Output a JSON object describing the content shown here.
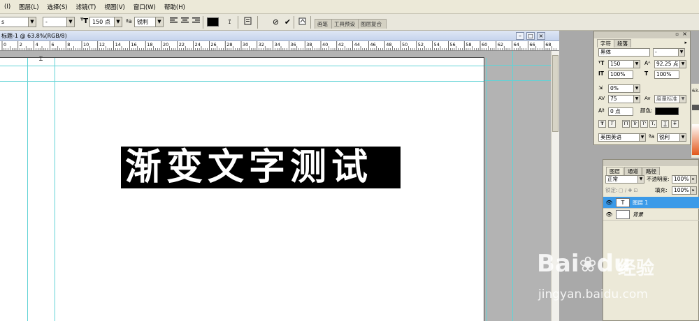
{
  "menu": [
    "图层(L)",
    "选择(S)",
    "滤镜(T)",
    "视图(V)",
    "窗口(W)",
    "帮助(H)"
  ],
  "menu_prefix": "(I)",
  "options": {
    "font_style": "-",
    "font_size": "150 点",
    "aa_label": "a",
    "aa_value": "锐利",
    "tabs": [
      "画笔",
      "工具预设",
      "图层复合"
    ]
  },
  "document": {
    "title": "标题-1 @ 63.8%(RGB/8)",
    "text": "渐变文字测试",
    "ruler_labels": [
      "0",
      "2",
      "4",
      "6",
      "8",
      "10",
      "12",
      "14",
      "16",
      "18",
      "20",
      "22",
      "24",
      "26",
      "28",
      "30",
      "32",
      "34",
      "36",
      "38",
      "40",
      "42",
      "44",
      "46",
      "48",
      "50",
      "52",
      "54",
      "56",
      "58",
      "60",
      "62",
      "64",
      "66",
      "68"
    ]
  },
  "char_panel": {
    "tab_char": "字符",
    "tab_para": "段落",
    "font_family": "黑体",
    "font_style": "-",
    "size": "150",
    "leading": "92.25 点",
    "vscale": "100%",
    "hscale": "100%",
    "tracking_pct": "0%",
    "kerning": "75",
    "kerning_mode": "度量标准",
    "baseline": "0 点",
    "color_label": "颜色:",
    "style_buttons": [
      "T",
      "T",
      "TT",
      "Tr",
      "T'",
      "T,",
      "T",
      "T"
    ],
    "language": "美国英语",
    "aa_label": "a",
    "aa_value": "锐利"
  },
  "side_readout": "63.",
  "layers_panel": {
    "tabs": [
      "图层",
      "通道",
      "路径"
    ],
    "blend_mode": "正常",
    "opacity_label": "不透明度:",
    "opacity": "100%",
    "lock_label": "锁定:",
    "fill_label": "填充:",
    "fill": "100%",
    "layers": [
      {
        "name": "图层 1",
        "thumb": "T",
        "selected": true
      },
      {
        "name": "背景",
        "thumb": "",
        "selected": false
      }
    ]
  },
  "watermark": {
    "brand": "Bai",
    "brand2": "du",
    "cn": "经验",
    "url": "jingyan.baidu.com"
  },
  "colors": {
    "selected_layer": "#3b9ae8",
    "guide": "#62d3d6"
  }
}
